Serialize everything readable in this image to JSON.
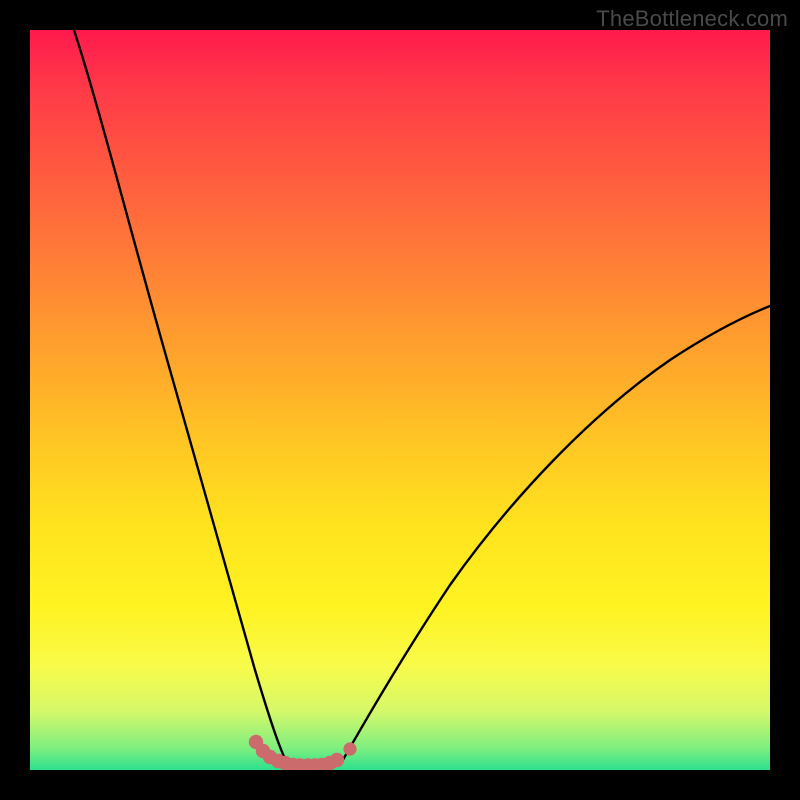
{
  "watermark": {
    "text": "TheBottleneck.com"
  },
  "chart_data": {
    "type": "line",
    "title": "",
    "xlabel": "",
    "ylabel": "",
    "xlim": [
      0,
      100
    ],
    "ylim": [
      0,
      100
    ],
    "gradient_stops": [
      {
        "pct": 0,
        "color": "#ff1a4d"
      },
      {
        "pct": 8,
        "color": "#ff3a48"
      },
      {
        "pct": 18,
        "color": "#ff5740"
      },
      {
        "pct": 30,
        "color": "#ff7a38"
      },
      {
        "pct": 42,
        "color": "#ff9e2e"
      },
      {
        "pct": 55,
        "color": "#ffc424"
      },
      {
        "pct": 67,
        "color": "#ffe31e"
      },
      {
        "pct": 78,
        "color": "#fff322"
      },
      {
        "pct": 86,
        "color": "#f8fb4a"
      },
      {
        "pct": 92,
        "color": "#d6f86a"
      },
      {
        "pct": 97,
        "color": "#7fef7f"
      },
      {
        "pct": 100,
        "color": "#2de08f"
      }
    ],
    "series": [
      {
        "name": "left-curve",
        "x": [
          6,
          10,
          14,
          18,
          22,
          25,
          28,
          30,
          32,
          34
        ],
        "y": [
          100,
          86,
          70,
          53,
          35,
          21,
          11,
          5,
          2,
          0.5
        ]
      },
      {
        "name": "right-curve",
        "x": [
          42,
          45,
          50,
          56,
          63,
          72,
          82,
          92,
          100
        ],
        "y": [
          0.5,
          3,
          9,
          17,
          27,
          38,
          48,
          56,
          62
        ]
      }
    ],
    "markers": {
      "name": "bottom-dots",
      "color": "#cc6b6b",
      "points": [
        {
          "x": 30.5,
          "y": 3.8,
          "r": 1.0
        },
        {
          "x": 31.5,
          "y": 2.6,
          "r": 1.0
        },
        {
          "x": 32.5,
          "y": 1.8,
          "r": 1.0
        },
        {
          "x": 33.5,
          "y": 1.2,
          "r": 1.0
        },
        {
          "x": 34.5,
          "y": 0.9,
          "r": 1.0
        },
        {
          "x": 35.5,
          "y": 0.7,
          "r": 1.0
        },
        {
          "x": 36.5,
          "y": 0.6,
          "r": 1.0
        },
        {
          "x": 37.5,
          "y": 0.6,
          "r": 1.0
        },
        {
          "x": 38.5,
          "y": 0.6,
          "r": 1.0
        },
        {
          "x": 39.5,
          "y": 0.7,
          "r": 1.0
        },
        {
          "x": 40.5,
          "y": 0.9,
          "r": 1.0
        },
        {
          "x": 41.5,
          "y": 1.4,
          "r": 1.0
        },
        {
          "x": 43.2,
          "y": 2.8,
          "r": 0.9
        }
      ]
    }
  }
}
